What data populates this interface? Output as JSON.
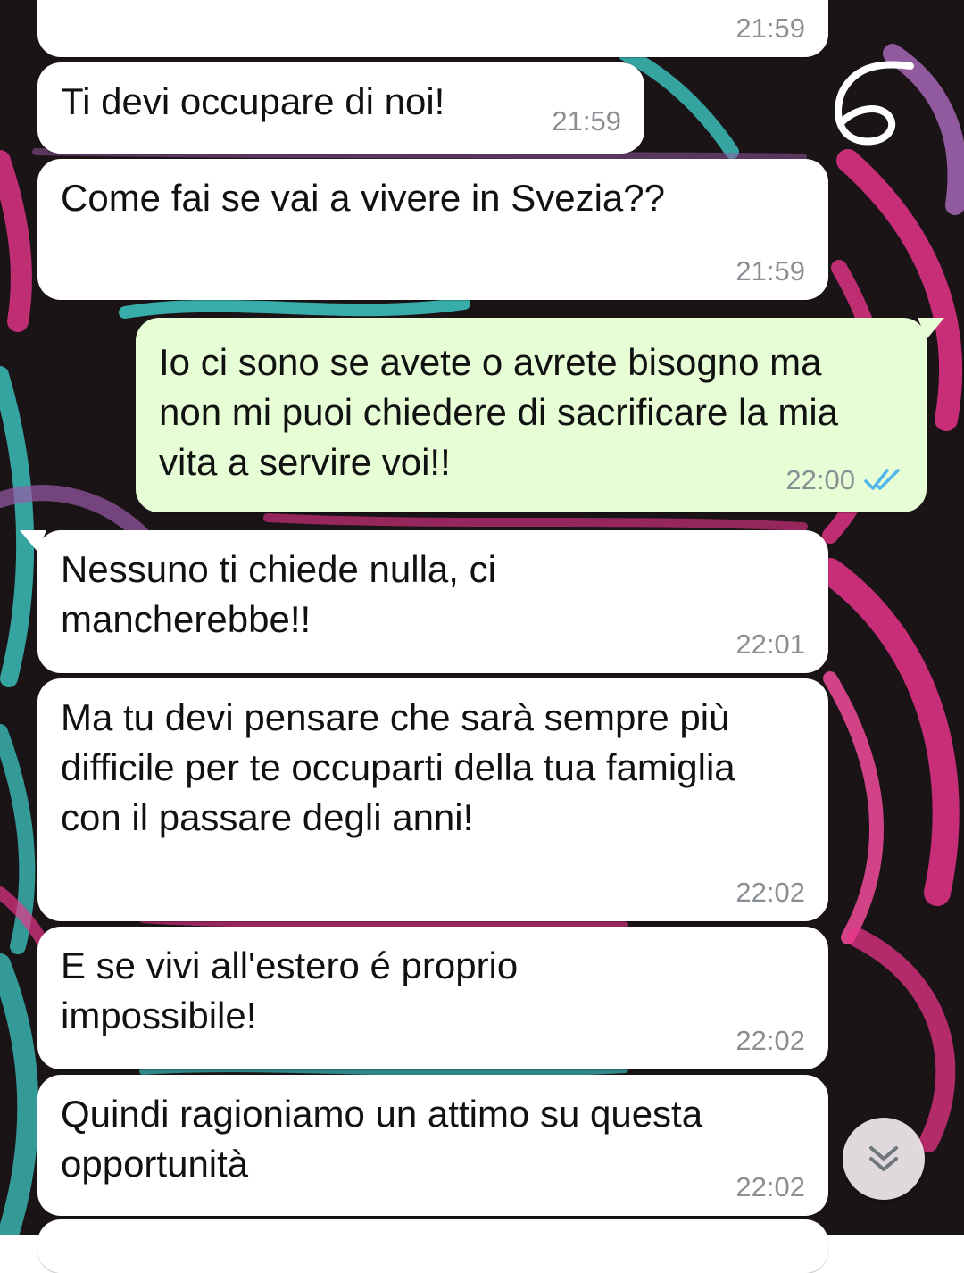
{
  "handwritten_mark": "6",
  "messages": [
    {
      "id": "m0",
      "direction": "incoming",
      "text": "",
      "time": "21:59"
    },
    {
      "id": "m1",
      "direction": "incoming",
      "text": "Ti devi occupare di noi!",
      "time": "21:59"
    },
    {
      "id": "m2",
      "direction": "incoming",
      "text": "Come fai se vai a vivere in Svezia??",
      "time": "21:59"
    },
    {
      "id": "m3",
      "direction": "outgoing",
      "text": "Io ci sono se avete o avrete bisogno ma non mi puoi chiedere di sacrificare la mia vita a servire voi!!",
      "time": "22:00",
      "status": "read"
    },
    {
      "id": "m4",
      "direction": "incoming",
      "text": "Nessuno ti chiede nulla, ci mancherebbe!!",
      "time": "22:01"
    },
    {
      "id": "m5",
      "direction": "incoming",
      "text": "Ma tu devi pensare che sarà sempre più difficile per te occuparti della tua famiglia con il passare degli anni!",
      "time": "22:02"
    },
    {
      "id": "m6",
      "direction": "incoming",
      "text": "E se vivi all'estero é proprio impossibile!",
      "time": "22:02"
    },
    {
      "id": "m7",
      "direction": "incoming",
      "text": "Quindi ragioniamo un attimo su questa opportunità",
      "time": "22:02"
    }
  ],
  "colors": {
    "incoming_bubble": "#ffffff",
    "outgoing_bubble": "#e7fdd6",
    "timestamp": "#8a8f94",
    "read_ticks": "#4fb6ec",
    "wallpaper_base": "#1a1417",
    "wallpaper_pink": "#e8338a",
    "wallpaper_cyan": "#3fd3cf",
    "wallpaper_purple": "#9a5aa8"
  },
  "icons": {
    "read_receipt": "double-check-icon",
    "scroll_down": "chevron-double-down-icon"
  }
}
